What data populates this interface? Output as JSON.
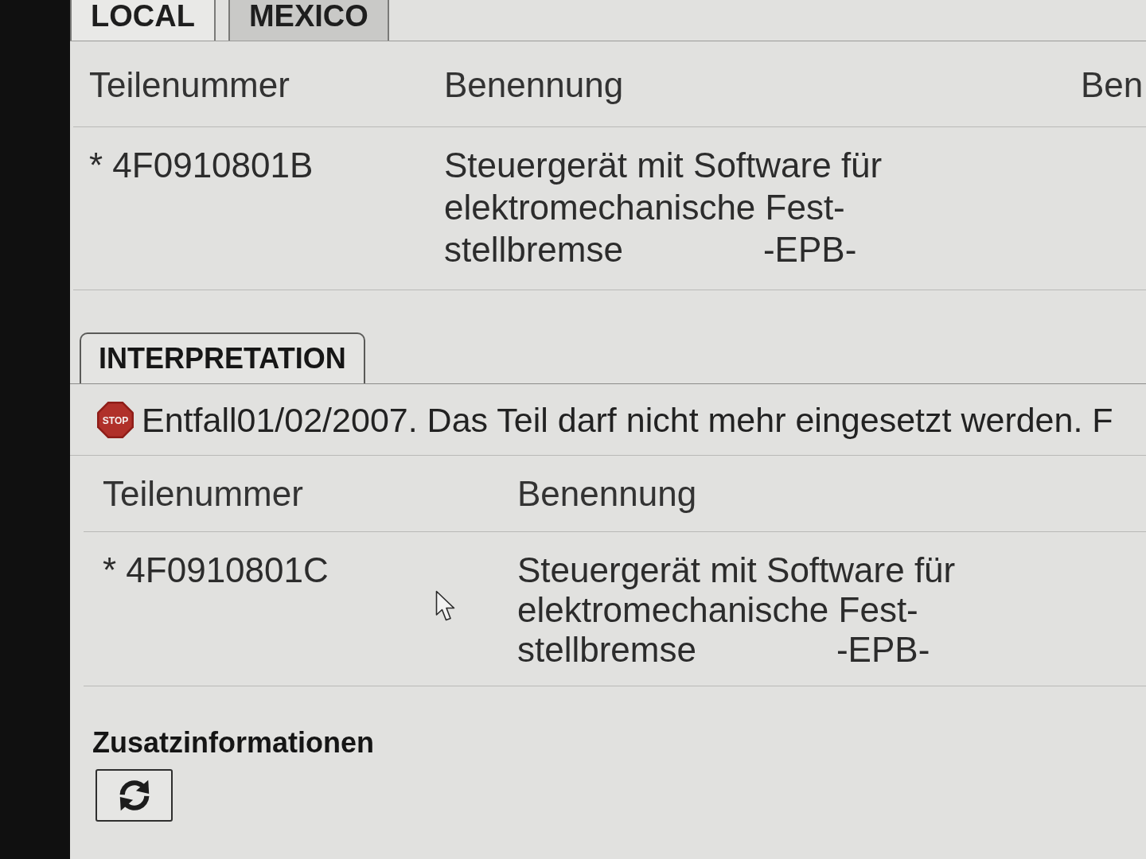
{
  "tabs": [
    {
      "label": "LOCAL",
      "selected": true
    },
    {
      "label": "MEXICO",
      "selected": false
    }
  ],
  "parts_table": {
    "columns": [
      "Teilenummer",
      "Benennung",
      "Ben"
    ],
    "rows": [
      {
        "part_number": "* 4F0910801B",
        "description_lines": [
          "Steuergerät mit Software für",
          "elektromechanische Fest-",
          "stellbremse"
        ],
        "code": "-EPB-"
      }
    ]
  },
  "interpretation": {
    "tab_label": "INTERPRETATION",
    "message": {
      "icon_text": "STOP",
      "text": "Entfall01/02/2007. Das Teil darf nicht mehr eingesetzt werden. F"
    },
    "table": {
      "columns": [
        "Teilenummer",
        "Benennung"
      ],
      "rows": [
        {
          "part_number": "* 4F0910801C",
          "description_lines": [
            "Steuergerät mit Software für",
            "elektromechanische Fest-",
            "stellbremse"
          ],
          "code": "-EPB-"
        }
      ]
    }
  },
  "additional_info": {
    "title": "Zusatzinformationen"
  }
}
